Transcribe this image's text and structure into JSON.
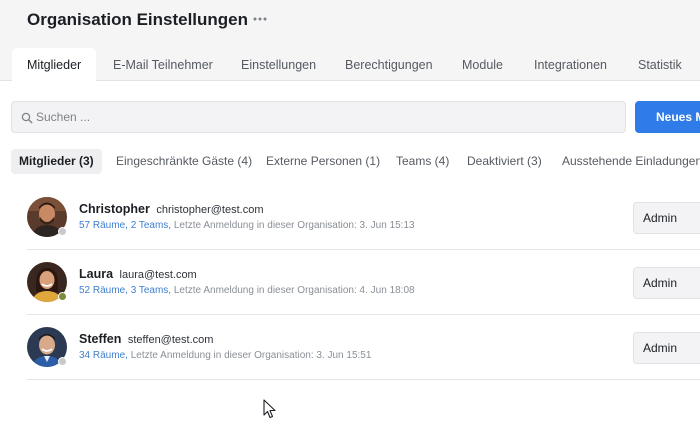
{
  "header": {
    "title": "Organisation Einstellungen",
    "more_icon": "ellipsis-icon",
    "tabs": [
      {
        "label": "Mitglieder",
        "active": true
      },
      {
        "label": "E-Mail Teilnehmer",
        "active": false
      },
      {
        "label": "Einstellungen",
        "active": false
      },
      {
        "label": "Berechtigungen",
        "active": false
      },
      {
        "label": "Module",
        "active": false
      },
      {
        "label": "Integrationen",
        "active": false
      },
      {
        "label": "Statistik",
        "active": false
      }
    ]
  },
  "search": {
    "placeholder": "Suchen ...",
    "value": "",
    "icon": "search-icon"
  },
  "new_member_button": "Neues M",
  "subtabs": [
    {
      "label": "Mitglieder (3)",
      "active": true
    },
    {
      "label": "Eingeschränkte Gäste (4)",
      "active": false
    },
    {
      "label": "Externe Personen (1)",
      "active": false
    },
    {
      "label": "Teams (4)",
      "active": false
    },
    {
      "label": "Deaktiviert (3)",
      "active": false
    },
    {
      "label": "Ausstehende Einladungen",
      "active": false
    }
  ],
  "members": [
    {
      "name": "Christopher",
      "email": "christopher@test.com",
      "rooms_teams": "57 Räume, 2 Teams,",
      "last_login": "Letzte Anmeldung in dieser Organisation: 3. Jun 15:13",
      "role": "Admin",
      "status_color": "#c9c9cc"
    },
    {
      "name": "Laura",
      "email": "laura@test.com",
      "rooms_teams": "52 Räume, 3 Teams,",
      "last_login": "Letzte Anmeldung in dieser Organisation: 4. Jun 18:08",
      "role": "Admin",
      "status_color": "#7c8a3a"
    },
    {
      "name": "Steffen",
      "email": "steffen@test.com",
      "rooms_teams": "34 Räume,",
      "last_login": "Letzte Anmeldung in dieser Organisation: 3. Jun 15:51",
      "role": "Admin",
      "status_color": "#c9c9cc"
    }
  ],
  "colors": {
    "accent": "#2f7be8",
    "link": "#3d7fcf",
    "header_bg": "#f5f5f6"
  }
}
